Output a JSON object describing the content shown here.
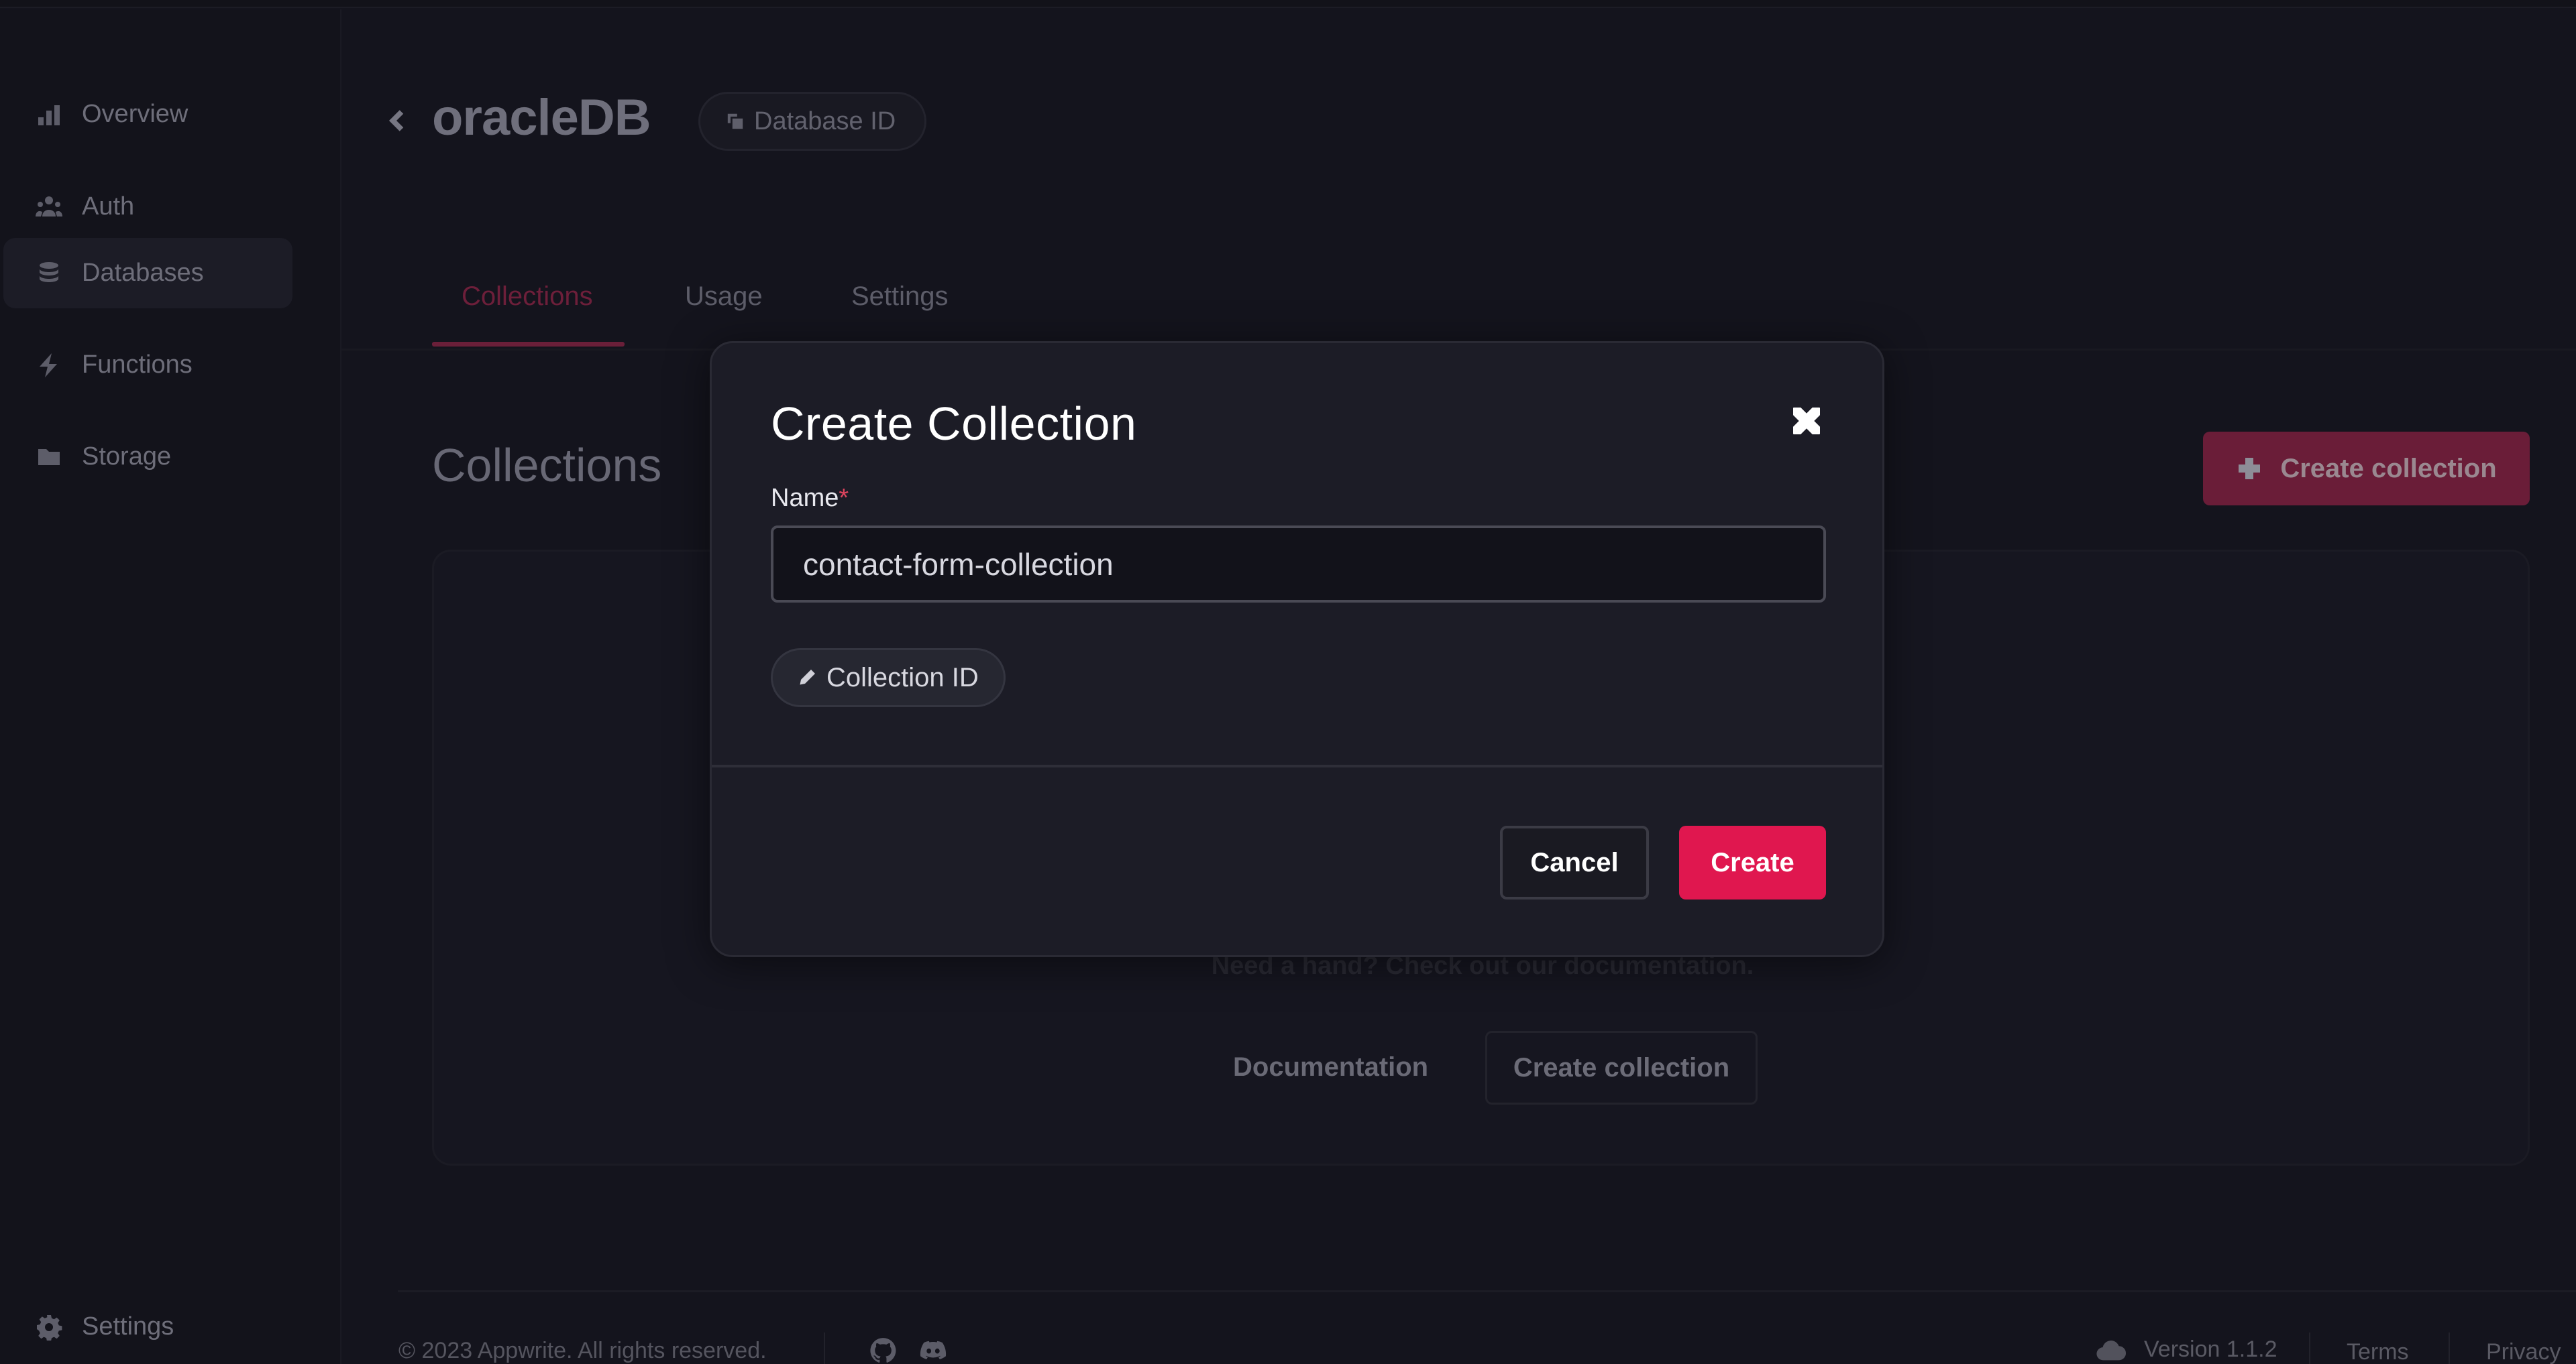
{
  "sidebar": {
    "items": [
      {
        "label": "Overview",
        "icon": "bar-chart-icon",
        "active": false
      },
      {
        "label": "Auth",
        "icon": "users-icon",
        "active": false
      },
      {
        "label": "Databases",
        "icon": "database-icon",
        "active": true
      },
      {
        "label": "Functions",
        "icon": "lightning-icon",
        "active": false
      },
      {
        "label": "Storage",
        "icon": "folder-icon",
        "active": false
      }
    ],
    "settings_label": "Settings"
  },
  "header": {
    "title": "oracleDB",
    "badge_label": "Database ID"
  },
  "tabs": [
    {
      "label": "Collections",
      "active": true
    },
    {
      "label": "Usage",
      "active": false
    },
    {
      "label": "Settings",
      "active": false
    }
  ],
  "main": {
    "section_title": "Collections",
    "create_button_label": "Create collection",
    "empty_state": {
      "help_text": "Need a hand? Check out our documentation.",
      "documentation_label": "Documentation",
      "create_button_label": "Create collection"
    }
  },
  "footer": {
    "copyright": "© 2023 Appwrite. All rights reserved.",
    "version": "Version 1.1.2",
    "terms_label": "Terms",
    "privacy_label": "Privacy"
  },
  "modal": {
    "title": "Create Collection",
    "name_label": "Name",
    "required_marker": "*",
    "name_value": "contact-form-collection",
    "collection_id_label": "Collection ID",
    "cancel_label": "Cancel",
    "create_label": "Create"
  },
  "colors": {
    "accent": "#e0174f",
    "background": "#14141d",
    "modal_background": "#1c1c26"
  }
}
